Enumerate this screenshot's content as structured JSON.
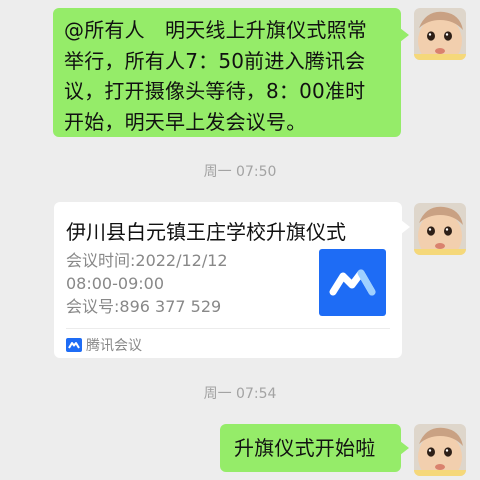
{
  "messages": {
    "first_text": [
      "@所有人　明天线上升旗仪式照常",
      "举行，所有人7：50前进入腾讯会",
      "议，打开摄像头等待，8：00准时",
      "开始，明天早上发会议号。"
    ],
    "time1": "周一 07:50",
    "card": {
      "title": "伊川县白元镇王庄学校升旗仪式",
      "desc": [
        "会议时间:2022/12/12",
        "08:00-09:00",
        "会议号:896 377 529"
      ],
      "source": "腾讯会议",
      "logo_icon": "tencent-meeting-logo-icon",
      "logo_color": "#1e6cf5"
    },
    "time2": "周一 07:54",
    "last_text": "升旗仪式开始啦"
  },
  "colors": {
    "background": "#ededed",
    "bubble_green": "#95ec69",
    "card_bg": "#ffffff",
    "meta_gray": "#a3a3a3"
  },
  "avatar_icon": "baby-avatar"
}
